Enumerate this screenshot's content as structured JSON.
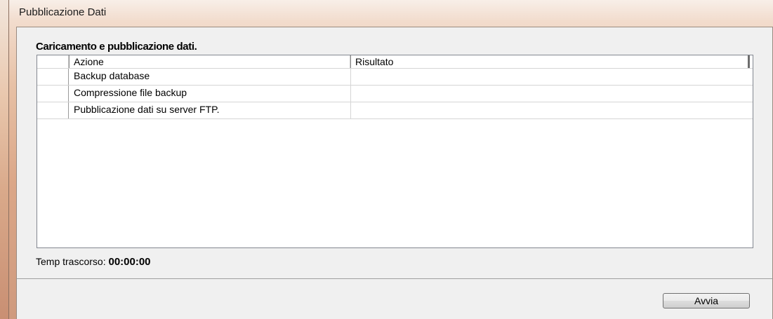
{
  "window": {
    "title": "Pubblicazione Dati"
  },
  "main": {
    "heading": "Caricamento e pubblicazione dati.",
    "columns": [
      "Azione",
      "Risultato"
    ],
    "rows": [
      {
        "azione": "Backup database",
        "risultato": ""
      },
      {
        "azione": "Compressione file backup",
        "risultato": ""
      },
      {
        "azione": "Pubblicazione dati su server FTP.",
        "risultato": ""
      }
    ],
    "elapsed_label": "Temp trascorso:",
    "elapsed_value": "00:00:00"
  },
  "footer": {
    "start_button_label": "Avvia"
  }
}
